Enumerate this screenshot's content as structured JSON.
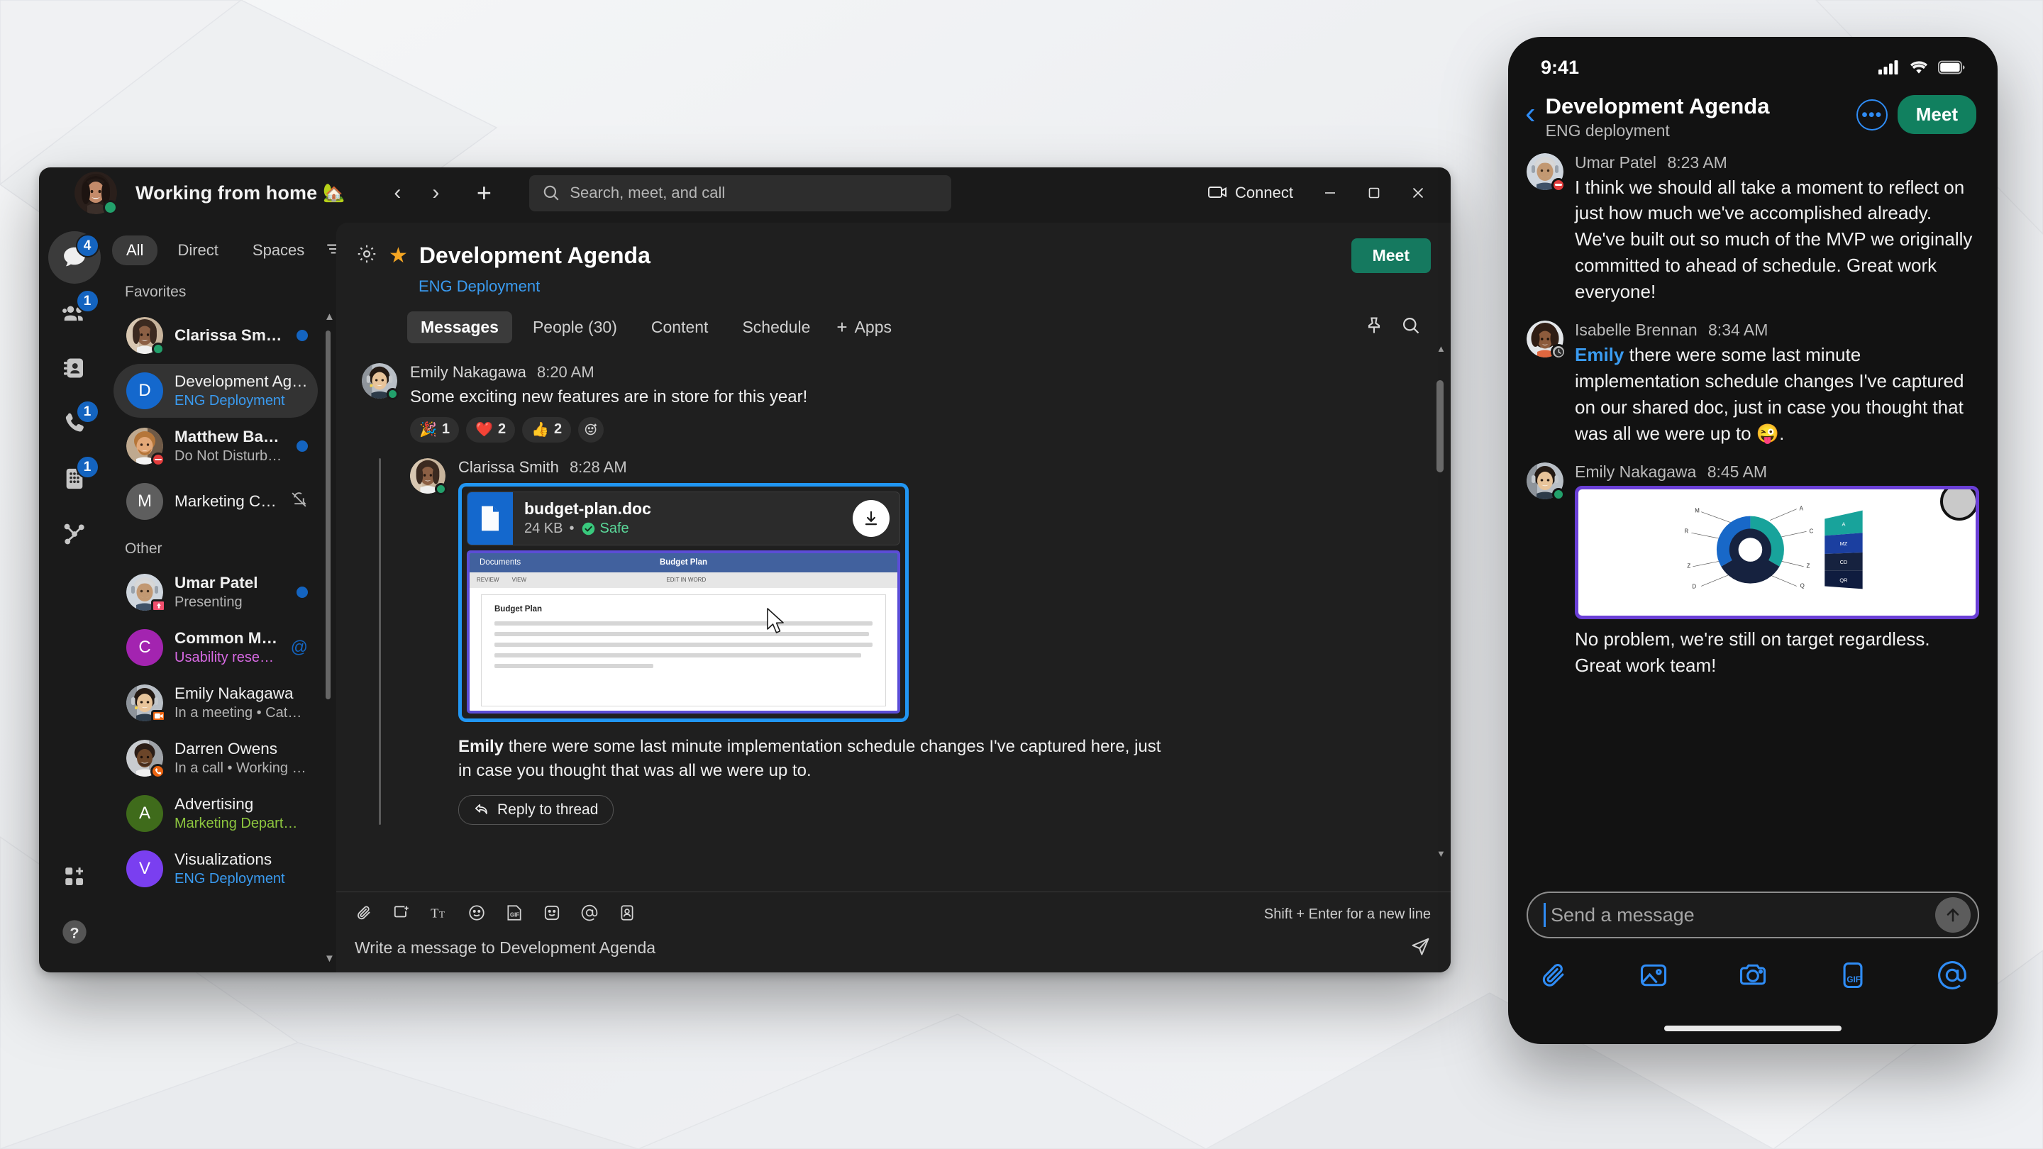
{
  "desktop": {
    "titlebar": {
      "status_text": "Working from home",
      "status_emoji": "🏡",
      "nav_back_icon": "chevron-left-icon",
      "nav_forward_icon": "chevron-right-icon",
      "new_icon": "plus-icon",
      "search_placeholder": "Search, meet, and call",
      "connect_label": "Connect",
      "minimize_label": "—",
      "maximize_label": "▢",
      "close_label": "✕"
    },
    "rail": [
      {
        "name": "messages",
        "icon": "chat-bubble-icon",
        "badge": "4",
        "active": true
      },
      {
        "name": "teams",
        "icon": "people-icon",
        "badge": "1",
        "active": false
      },
      {
        "name": "contacts",
        "icon": "contact-card-icon",
        "badge": "",
        "active": false
      },
      {
        "name": "calls",
        "icon": "phone-icon",
        "badge": "1",
        "active": false
      },
      {
        "name": "voicemail",
        "icon": "keypad-icon",
        "badge": "1",
        "active": false
      },
      {
        "name": "workflows",
        "icon": "workflow-icon",
        "badge": "",
        "active": false
      },
      {
        "name": "apps",
        "icon": "apps-add-icon",
        "badge": "",
        "active": false
      },
      {
        "name": "help",
        "icon": "help-icon",
        "badge": "",
        "active": false
      }
    ],
    "chatlist": {
      "filters": [
        {
          "label": "All",
          "active": true
        },
        {
          "label": "Direct",
          "active": false
        },
        {
          "label": "Spaces",
          "active": false
        }
      ],
      "filter_menu_icon": "filter-icon",
      "sections": [
        {
          "title": "Favorites",
          "items": [
            {
              "name": "Clarissa Smith",
              "sub": "",
              "avatar_type": "photo",
              "photo": "woman-braids",
              "presence": "available",
              "badge": "dot",
              "selected": false,
              "unread": true
            },
            {
              "name": "Development Agenda",
              "sub": "ENG Deployment",
              "avatar_type": "mono",
              "initial": "D",
              "color": "#1468cd",
              "sub_color": "#3a9bf0",
              "presence": "",
              "badge": "",
              "selected": true,
              "unread": false
            },
            {
              "name": "Matthew Baker",
              "sub": "Do Not Disturb  •  Out for a walk",
              "avatar_type": "photo",
              "photo": "man-beard",
              "presence": "dnd",
              "badge": "dot",
              "selected": false,
              "unread": true
            },
            {
              "name": "Marketing Collateral",
              "sub": "",
              "avatar_type": "mono",
              "initial": "M",
              "color": "#5e5e5e",
              "presence": "",
              "badge": "mute",
              "selected": false,
              "unread": false
            }
          ]
        },
        {
          "title": "Other",
          "items": [
            {
              "name": "Umar Patel",
              "sub": "Presenting",
              "avatar_type": "photo",
              "photo": "man-gray",
              "presence": "presenting",
              "badge": "dot",
              "selected": false,
              "unread": true
            },
            {
              "name": "Common Metrics",
              "sub": "Usability research",
              "avatar_type": "mono",
              "initial": "C",
              "color": "#a324b0",
              "sub_color": "#d86ae4",
              "presence": "",
              "badge": "mention",
              "selected": false,
              "unread": true
            },
            {
              "name": "Emily Nakagawa",
              "sub": "In a meeting  •  Catching up 📖",
              "avatar_type": "photo",
              "photo": "woman-headset",
              "presence": "meeting",
              "badge": "",
              "selected": false,
              "unread": false
            },
            {
              "name": "Darren Owens",
              "sub": "In a call  •  Working from home 🏡",
              "avatar_type": "photo",
              "photo": "man-dark",
              "presence": "call",
              "badge": "",
              "selected": false,
              "unread": false
            },
            {
              "name": "Advertising",
              "sub": "Marketing Department",
              "avatar_type": "mono",
              "initial": "A",
              "color": "#3f6b1b",
              "sub_color": "#8dc63f",
              "presence": "",
              "badge": "",
              "selected": false,
              "unread": false
            },
            {
              "name": "Visualizations",
              "sub": "ENG Deployment",
              "avatar_type": "mono",
              "initial": "V",
              "color": "#7a3ff0",
              "sub_color": "#3a9bf0",
              "presence": "",
              "badge": "",
              "selected": false,
              "unread": false
            }
          ]
        }
      ]
    },
    "chat": {
      "gear_icon": "gear-icon",
      "star_icon": "star-filled-icon",
      "title": "Development Agenda",
      "subtitle": "ENG Deployment",
      "meet_label": "Meet",
      "tabs": [
        {
          "label": "Messages",
          "active": true
        },
        {
          "label": "People (30)",
          "active": false
        },
        {
          "label": "Content",
          "active": false
        },
        {
          "label": "Schedule",
          "active": false
        }
      ],
      "tab_add_label": "Apps",
      "pin_icon": "pin-icon",
      "search_icon": "search-icon",
      "messages": [
        {
          "author": "Emily Nakagawa",
          "time": "8:20 AM",
          "text": "Some exciting new features are in store for this year!",
          "presence": "available",
          "photo": "woman-headset",
          "reactions": [
            {
              "emoji": "🎉",
              "count": "1"
            },
            {
              "emoji": "❤️",
              "count": "2"
            },
            {
              "emoji": "👍",
              "count": "2"
            }
          ],
          "add_reaction_icon": "add-reaction-icon"
        }
      ],
      "thread": {
        "author": "Clarissa Smith",
        "time": "8:28 AM",
        "photo": "woman-braids",
        "presence": "available",
        "file": {
          "name": "budget-plan.doc",
          "size": "24 KB",
          "separator": "•",
          "safe_label": "Safe",
          "safe_icon": "check-circle-icon",
          "download_icon": "download-icon",
          "file_icon": "document-icon"
        },
        "doc_preview": {
          "ribbon_left": "Documents",
          "ribbon_title": "Budget Plan",
          "toolbar_items": [
            "REVIEW",
            "VIEW"
          ],
          "edit_label": "EDIT IN WORD",
          "heading": "Budget Plan",
          "body_lines": 5
        },
        "message_mention": "Emily",
        "message_text": " there were some last minute implementation schedule changes I've captured here, just in case you thought that was all we were up to.",
        "reply_label": "Reply to thread",
        "reply_icon": "reply-icon"
      },
      "composer": {
        "icons": [
          "attach-icon",
          "sticker-icon",
          "format-text-icon",
          "emoji-icon",
          "gif-icon",
          "meme-icon",
          "mention-icon",
          "contact-icon"
        ],
        "hint": "Shift + Enter for a new line",
        "placeholder": "Write a message to Development Agenda",
        "send_icon": "send-icon"
      }
    }
  },
  "phone": {
    "status": {
      "time": "9:41",
      "signal_icon": "cellular-icon",
      "wifi_icon": "wifi-icon",
      "battery_icon": "battery-icon"
    },
    "header": {
      "back_icon": "chevron-left-icon",
      "title": "Development Agenda",
      "subtitle": "ENG deployment",
      "more_icon": "more-horizontal-icon",
      "meet_label": "Meet"
    },
    "messages": [
      {
        "author": "Umar Patel",
        "time": "8:23 AM",
        "presence": "dnd",
        "photo": "man-gray",
        "text": "I think we should all take a moment to reflect on just how much we've accomplished already. We've built out so much of the MVP we originally committed to ahead of schedule. Great work everyone!"
      },
      {
        "author": "Isabelle Brennan",
        "time": "8:34 AM",
        "presence": "away",
        "photo": "woman-curly",
        "mention": "Emily",
        "text": " there were some last minute implementation schedule changes I've captured on our shared doc, just in case you thought that was all we were up to 😜."
      },
      {
        "author": "Emily Nakagawa",
        "time": "8:45 AM",
        "presence": "available",
        "photo": "woman-headset",
        "has_chart": true,
        "text": "No problem, we're still on target regardless. Great work team!"
      }
    ],
    "composer": {
      "placeholder": "Send a message",
      "send_icon": "arrow-up-icon",
      "icons": [
        "attach-icon",
        "image-icon",
        "camera-icon",
        "gif-icon",
        "mention-icon"
      ]
    }
  },
  "chart_data": {
    "type": "pie",
    "title": "",
    "labels_left": [
      "M",
      "R",
      "Z",
      "D"
    ],
    "labels_right": [
      "A",
      "C",
      "Z",
      "Q"
    ],
    "bar_labels": [
      "A",
      "MZ",
      "CD",
      "QR"
    ],
    "values": [
      38,
      26,
      20,
      16
    ],
    "colors": [
      "#18a39b",
      "#1868c8",
      "#1b2a6b",
      "#0f1c3f"
    ]
  }
}
